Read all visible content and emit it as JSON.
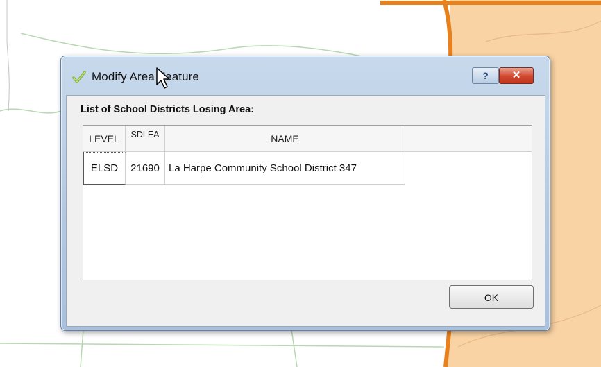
{
  "dialog": {
    "title": "Modify Area Feature",
    "help_label": "?",
    "close_label": "✕",
    "list_heading": "List of School Districts Losing Area:",
    "ok_label": "OK"
  },
  "table": {
    "columns": [
      "LEVEL",
      "SDLEA",
      "NAME"
    ],
    "rows": [
      [
        "ELSD",
        "21690",
        "La Harpe Community School District 347"
      ]
    ]
  },
  "colors": {
    "map_fill": "#f9d3a3",
    "map_boundary": "#e8801d",
    "dialog_frame": "#b3c8e0",
    "close_button": "#d0472f"
  },
  "icons": {
    "app_icon": "checkmark-icon",
    "cursor": "mouse-pointer-icon"
  }
}
